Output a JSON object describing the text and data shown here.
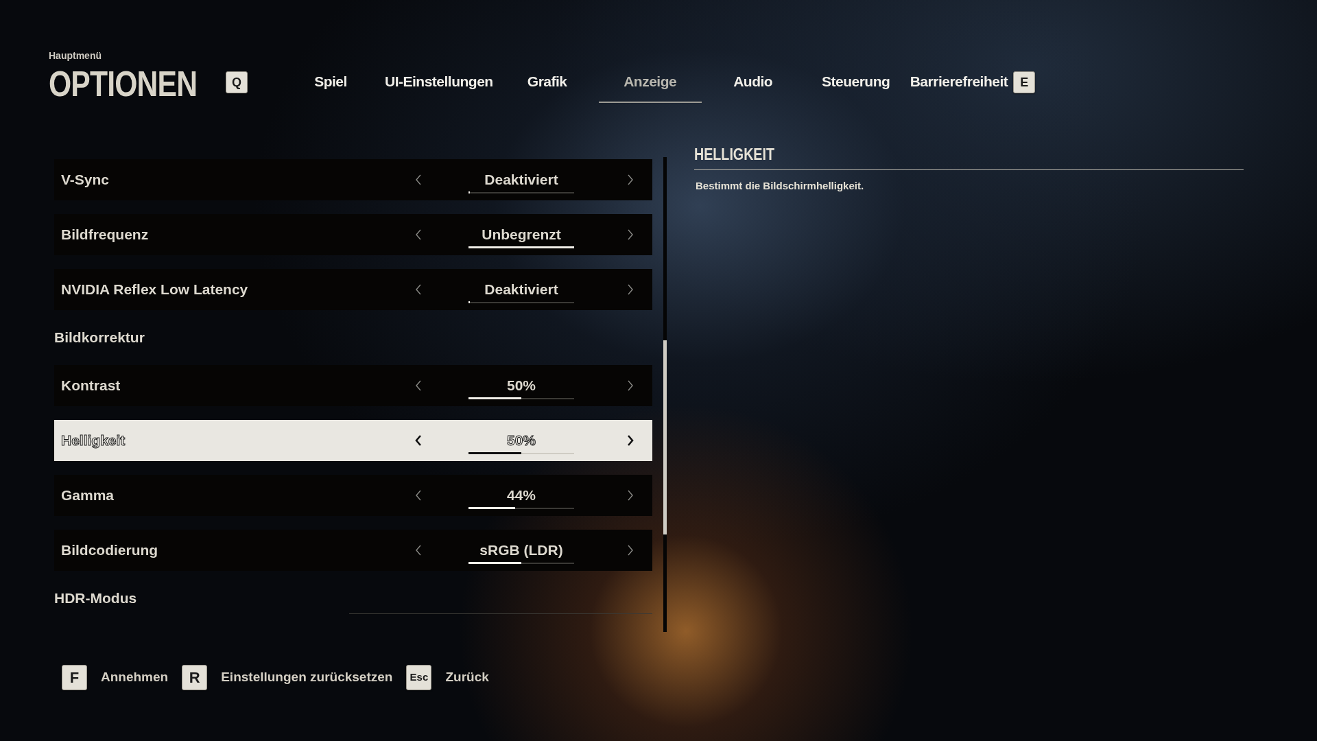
{
  "header": {
    "breadcrumb": "Hauptmenü",
    "title": "OPTIONEN"
  },
  "tabs": {
    "prev_key": "Q",
    "next_key": "E",
    "items": [
      {
        "label": "Spiel",
        "selected": false
      },
      {
        "label": "UI-Einstellungen",
        "selected": false
      },
      {
        "label": "Grafik",
        "selected": false
      },
      {
        "label": "Anzeige",
        "selected": true
      },
      {
        "label": "Audio",
        "selected": false
      },
      {
        "label": "Steuerung",
        "selected": false
      },
      {
        "label": "Barrierefreiheit",
        "selected": false
      }
    ]
  },
  "settings": [
    {
      "kind": "option",
      "label": "V-Sync",
      "value": "Deaktiviert",
      "level": 0,
      "selected": false
    },
    {
      "kind": "option",
      "label": "Bildfrequenz",
      "value": "Unbegrenzt",
      "level": 1,
      "selected": false
    },
    {
      "kind": "option",
      "label": "NVIDIA Reflex Low Latency",
      "value": "Deaktiviert",
      "level": 0,
      "selected": false
    },
    {
      "kind": "section",
      "label": "Bildkorrektur"
    },
    {
      "kind": "option",
      "label": "Kontrast",
      "value": "50%",
      "level": 0.5,
      "selected": false
    },
    {
      "kind": "option",
      "label": "Helligkeit",
      "value": "50%",
      "level": 0.5,
      "selected": true
    },
    {
      "kind": "option",
      "label": "Gamma",
      "value": "44%",
      "level": 0.44,
      "selected": false
    },
    {
      "kind": "option",
      "label": "Bildcodierung",
      "value": "sRGB (LDR)",
      "level": 0.5,
      "selected": false
    },
    {
      "kind": "section",
      "label": "HDR-Modus"
    }
  ],
  "description": {
    "title": "HELLIGKEIT",
    "text": "Bestimmt die Bildschirmhelligkeit."
  },
  "footer": [
    {
      "key": "F",
      "label": "Annehmen"
    },
    {
      "key": "R",
      "label": "Einstellungen zurücksetzen"
    },
    {
      "key": "Esc",
      "label": "Zurück"
    }
  ]
}
